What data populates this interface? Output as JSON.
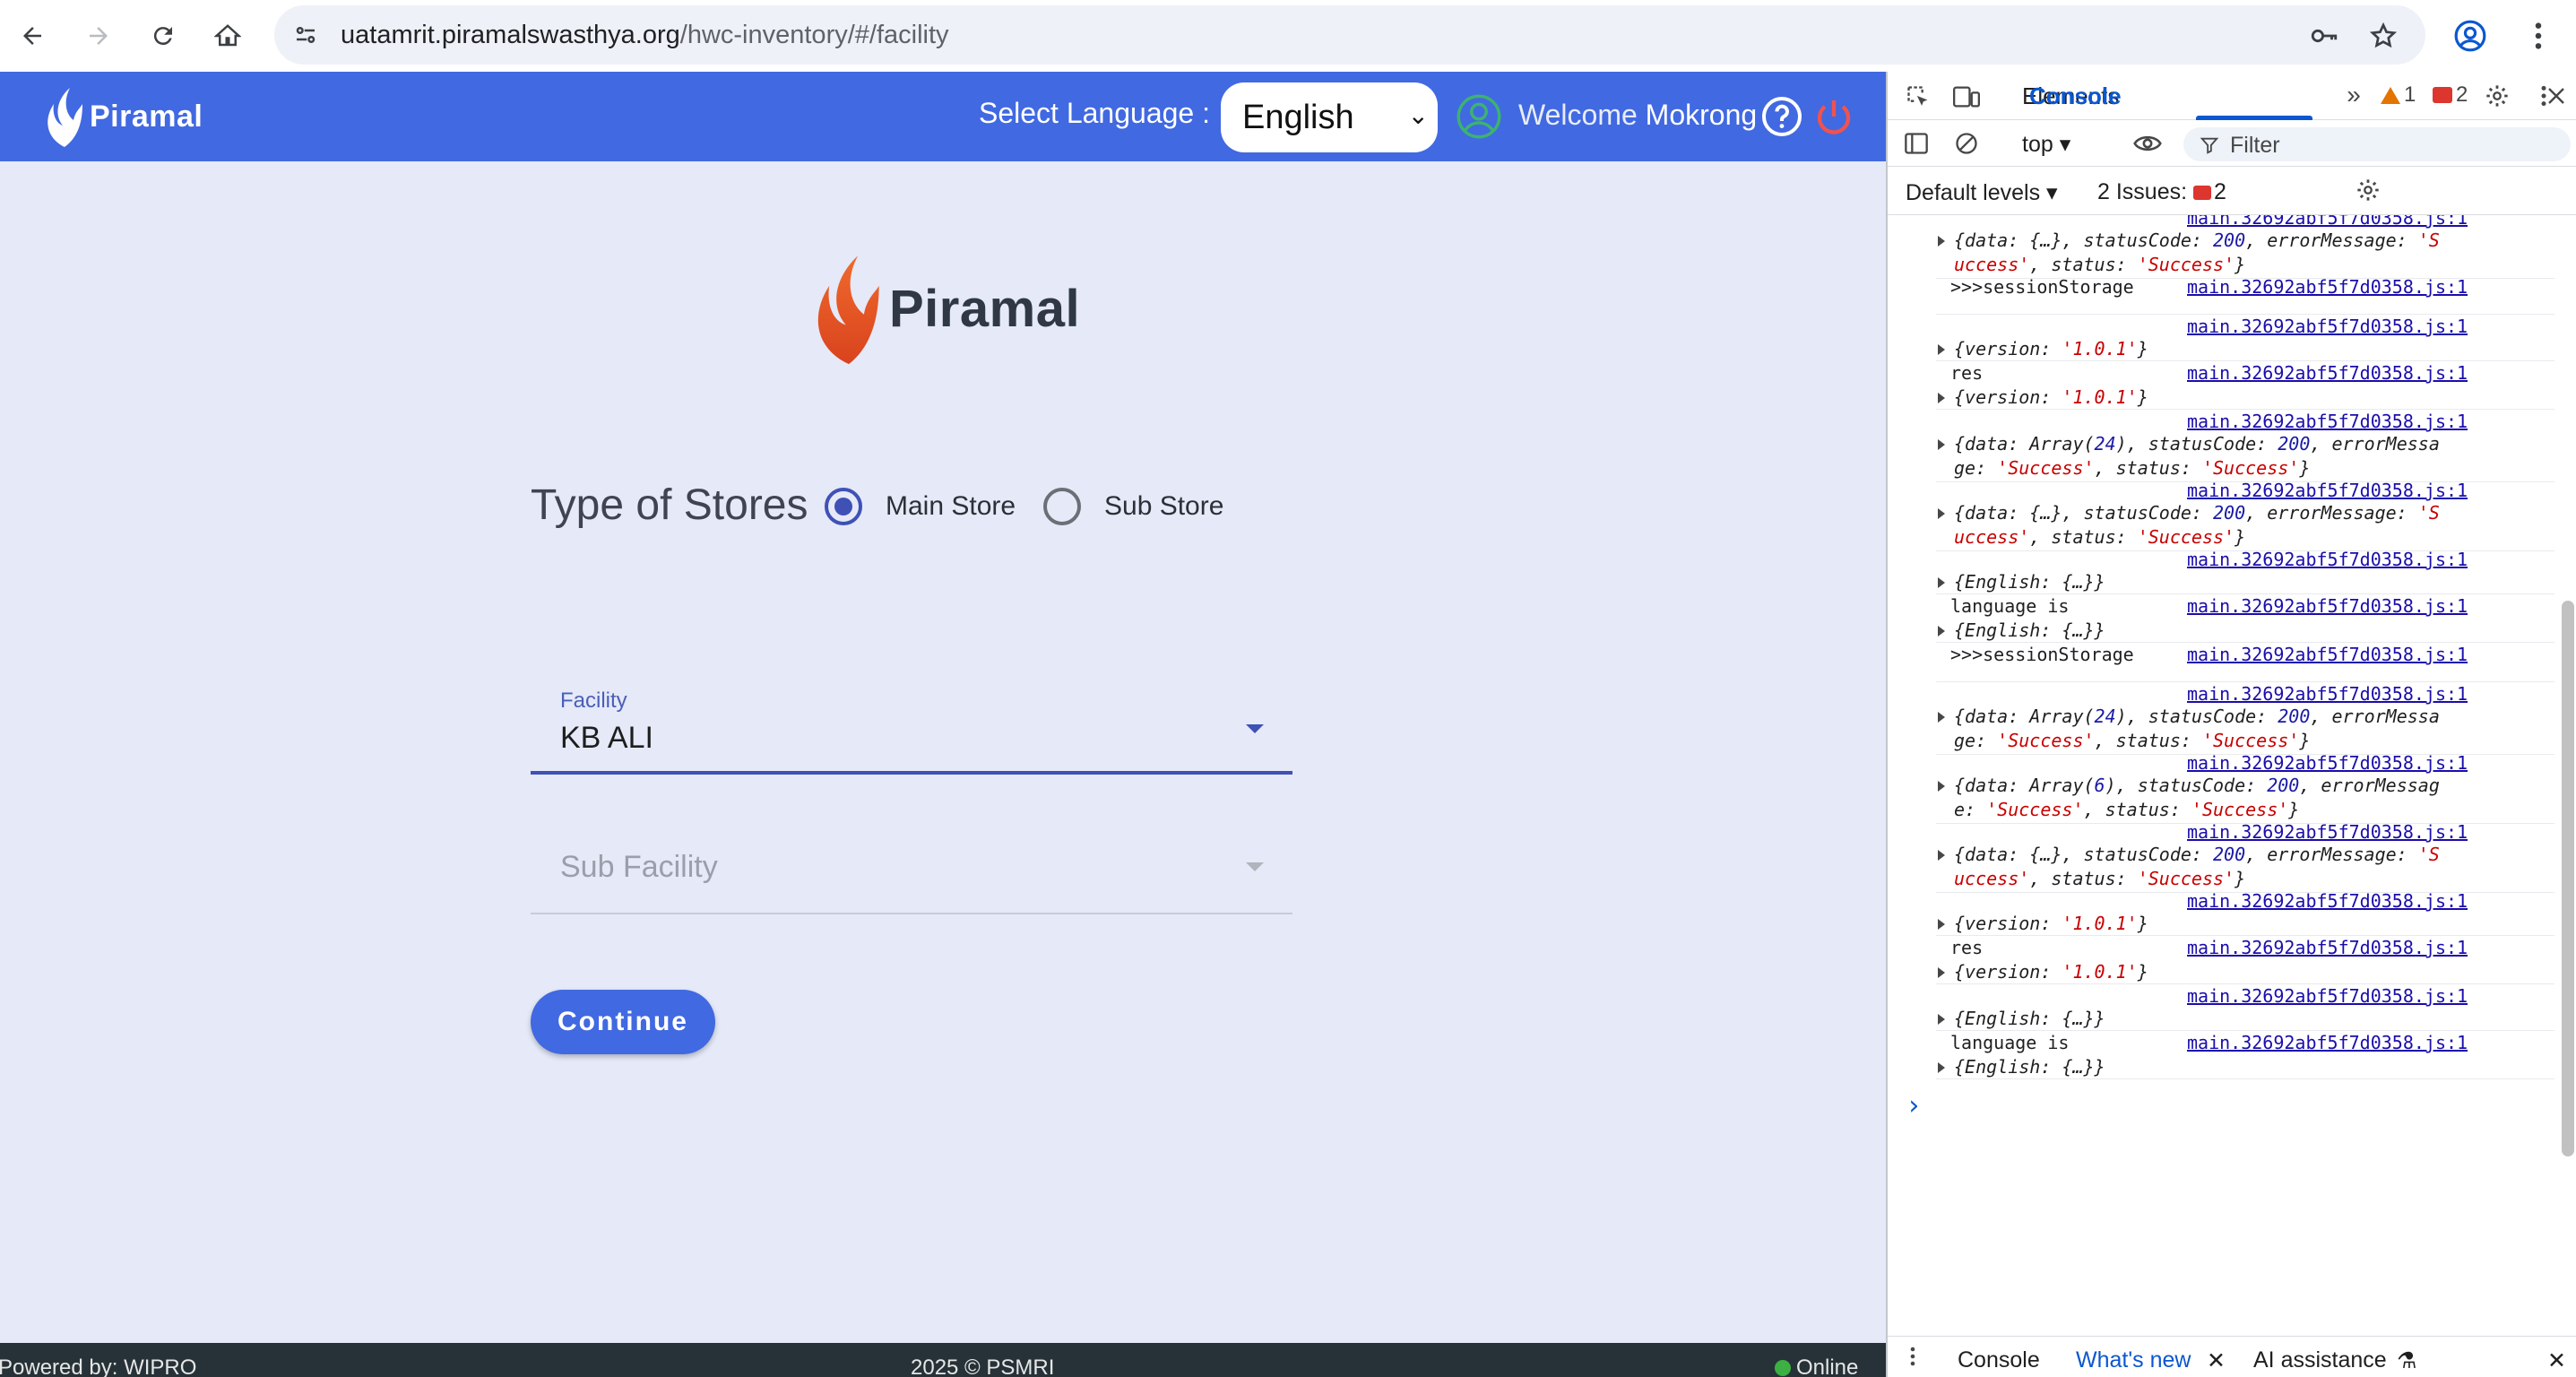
{
  "browser": {
    "url_host": "uatamrit.piramalswasthya.org",
    "url_path": "/hwc-inventory/#/facility"
  },
  "header": {
    "brand": "Piramal",
    "select_language_label": "Select Language :",
    "language_value": "English",
    "welcome_prefix": "Welcome",
    "user_name": "Mokrong"
  },
  "main": {
    "brand": "Piramal",
    "stores_title": "Type of Stores",
    "store_options": [
      {
        "label": "Main Store",
        "checked": true
      },
      {
        "label": "Sub Store",
        "checked": false
      }
    ],
    "facility_label": "Facility",
    "facility_value": "KB ALI",
    "sub_facility_placeholder": "Sub Facility",
    "continue_label": "Continue"
  },
  "footer": {
    "powered_by": "Powered by: WIPRO",
    "copyright": "2025 © PSMRI",
    "status": "Online"
  },
  "devtools": {
    "tabs": [
      "Elements",
      "Console"
    ],
    "active_tab": "Console",
    "warnings_count": "1",
    "errors_count": "2",
    "context": "top",
    "filter_placeholder": "Filter",
    "levels": "Default levels",
    "issues_label": "2 Issues:",
    "issues_count": "2",
    "drawer_tabs": [
      "Console",
      "What's new",
      "AI assistance"
    ],
    "source": "main.32692abf5f7d0358.js:1",
    "logs": [
      {
        "msg": "",
        "obj": "{data: {…}, statusCode: 200, errorMessage: 'S\nuccess', status: 'Success'}"
      },
      {
        "msg": ">>>sessionStorage",
        "obj": ""
      },
      {
        "msg": "",
        "obj": "{version: '1.0.1'}"
      },
      {
        "msg": "res",
        "obj": "{version: '1.0.1'}"
      },
      {
        "msg": "",
        "obj": "{data: Array(24), statusCode: 200, errorMessa\nge: 'Success', status: 'Success'}"
      },
      {
        "msg": "",
        "obj": "{data: {…}, statusCode: 200, errorMessage: 'S\nuccess', status: 'Success'}"
      },
      {
        "msg": "",
        "obj": "{English: {…}}"
      },
      {
        "msg": "language is",
        "obj": "{English: {…}}"
      },
      {
        "msg": ">>>sessionStorage",
        "obj": ""
      },
      {
        "msg": "",
        "obj": "{data: Array(24), statusCode: 200, errorMessa\nge: 'Success', status: 'Success'}"
      },
      {
        "msg": "",
        "obj": "{data: Array(6), statusCode: 200, errorMessag\ne: 'Success', status: 'Success'}"
      },
      {
        "msg": "",
        "obj": "{data: {…}, statusCode: 200, errorMessage: 'S\nuccess', status: 'Success'}"
      },
      {
        "msg": "",
        "obj": "{version: '1.0.1'}"
      },
      {
        "msg": "res",
        "obj": "{version: '1.0.1'}"
      },
      {
        "msg": "",
        "obj": "{English: {…}}"
      },
      {
        "msg": "language is",
        "obj": "{English: {…}}"
      }
    ]
  },
  "colors": {
    "header_blue": "#4169e1",
    "page_bg": "#e5e9f8",
    "radio_indigo": "#3f51b5",
    "brand_orange": "#e8582a"
  },
  "icons": [
    "back-icon",
    "forward-icon",
    "reload-icon",
    "home-icon",
    "site-info-icon",
    "key-icon",
    "star-icon",
    "profile-icon",
    "menu-icon",
    "user-circle-icon",
    "help-icon",
    "power-icon"
  ]
}
